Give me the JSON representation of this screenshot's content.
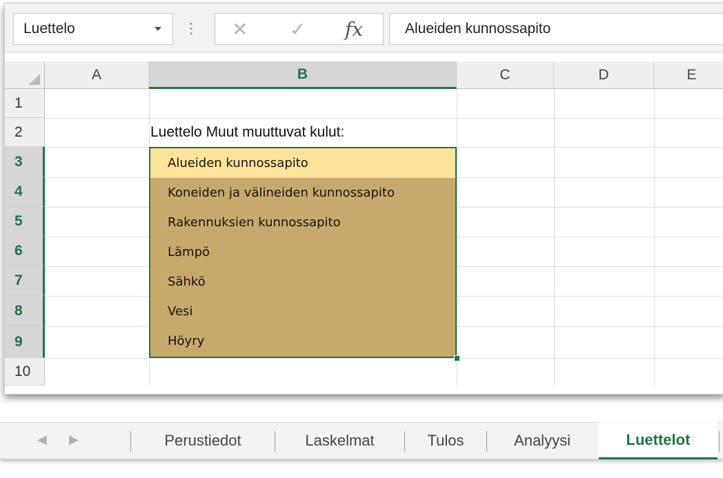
{
  "formula_bar": {
    "name_box": "Luettelo",
    "function_icon": "fx",
    "formula_value": "Alueiden kunnossapito"
  },
  "columns": [
    "A",
    "B",
    "C",
    "D",
    "E"
  ],
  "selected_column": "B",
  "rows": [
    "1",
    "2",
    "3",
    "4",
    "5",
    "6",
    "7",
    "8",
    "9",
    "10"
  ],
  "cells": {
    "B2": "Luettelo Muut muuttuvat kulut:"
  },
  "dropdown_list": {
    "items": [
      "Alueiden kunnossapito",
      "Koneiden ja välineiden kunnossapito",
      "Rakennuksien kunnossapito",
      "Lämpö",
      "Sähkö",
      "Vesi",
      "Höyry"
    ],
    "active_index": 0
  },
  "sheet_tabs": {
    "tabs": [
      "Perustiedot",
      "Laskelmat",
      "Tulos",
      "Analyysi",
      "Luettelot"
    ],
    "active": "Luettelot"
  },
  "colors": {
    "excel_green": "#217346",
    "list_background": "#c8a96d",
    "list_highlight": "#fde39a"
  }
}
